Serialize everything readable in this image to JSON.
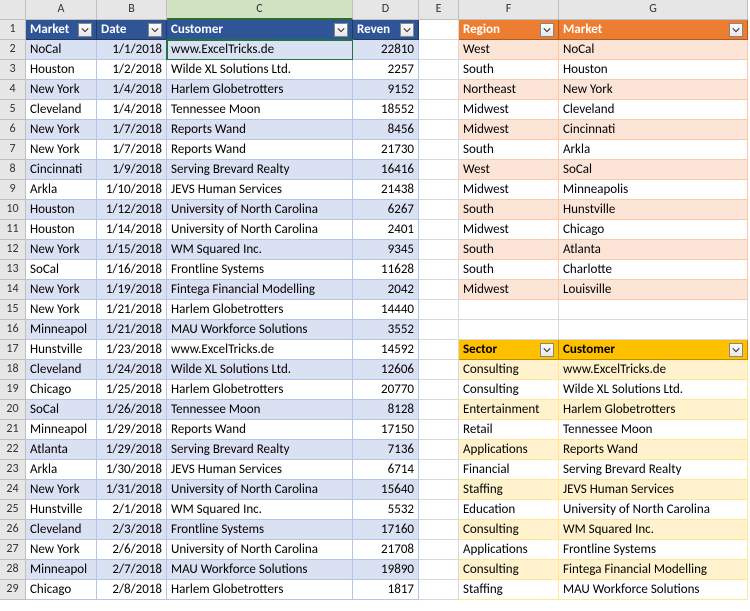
{
  "columns": [
    "A",
    "B",
    "C",
    "D",
    "E",
    "F",
    "G"
  ],
  "table1": {
    "headers": {
      "market": "Market",
      "date": "Date",
      "customer": "Customer",
      "reven": "Reven"
    },
    "rows": [
      {
        "market": "NoCal",
        "date": "1/1/2018",
        "customer": "www.ExcelTricks.de",
        "reven": 22810
      },
      {
        "market": "Houston",
        "date": "1/2/2018",
        "customer": "Wilde XL Solutions Ltd.",
        "reven": 2257
      },
      {
        "market": "New York",
        "date": "1/4/2018",
        "customer": "Harlem Globetrotters",
        "reven": 9152
      },
      {
        "market": "Cleveland",
        "date": "1/4/2018",
        "customer": "Tennessee Moon",
        "reven": 18552
      },
      {
        "market": "New York",
        "date": "1/7/2018",
        "customer": "Reports Wand",
        "reven": 8456
      },
      {
        "market": "New York",
        "date": "1/7/2018",
        "customer": "Reports Wand",
        "reven": 21730
      },
      {
        "market": "Cincinnati",
        "date": "1/9/2018",
        "customer": "Serving Brevard Realty",
        "reven": 16416
      },
      {
        "market": "Arkla",
        "date": "1/10/2018",
        "customer": "JEVS Human Services",
        "reven": 21438
      },
      {
        "market": "Houston",
        "date": "1/12/2018",
        "customer": "University of North Carolina",
        "reven": 6267
      },
      {
        "market": "Houston",
        "date": "1/14/2018",
        "customer": "University of North Carolina",
        "reven": 2401
      },
      {
        "market": "New York",
        "date": "1/15/2018",
        "customer": "WM Squared Inc.",
        "reven": 9345
      },
      {
        "market": "SoCal",
        "date": "1/16/2018",
        "customer": "Frontline Systems",
        "reven": 11628
      },
      {
        "market": "New York",
        "date": "1/19/2018",
        "customer": "Fintega Financial Modelling",
        "reven": 2042
      },
      {
        "market": "New York",
        "date": "1/21/2018",
        "customer": "Harlem Globetrotters",
        "reven": 14440
      },
      {
        "market": "Minneapol",
        "date": "1/21/2018",
        "customer": "MAU Workforce Solutions",
        "reven": 3552
      },
      {
        "market": "Hunstville",
        "date": "1/23/2018",
        "customer": "www.ExcelTricks.de",
        "reven": 14592
      },
      {
        "market": "Cleveland",
        "date": "1/24/2018",
        "customer": "Wilde XL Solutions Ltd.",
        "reven": 12606
      },
      {
        "market": "Chicago",
        "date": "1/25/2018",
        "customer": "Harlem Globetrotters",
        "reven": 20770
      },
      {
        "market": "SoCal",
        "date": "1/26/2018",
        "customer": "Tennessee Moon",
        "reven": 8128
      },
      {
        "market": "Minneapol",
        "date": "1/29/2018",
        "customer": "Reports Wand",
        "reven": 17150
      },
      {
        "market": "Atlanta",
        "date": "1/29/2018",
        "customer": "Serving Brevard Realty",
        "reven": 7136
      },
      {
        "market": "Arkla",
        "date": "1/30/2018",
        "customer": "JEVS Human Services",
        "reven": 6714
      },
      {
        "market": "New York",
        "date": "1/31/2018",
        "customer": "University of North Carolina",
        "reven": 15640
      },
      {
        "market": "Hunstville",
        "date": "2/1/2018",
        "customer": "WM Squared Inc.",
        "reven": 5532
      },
      {
        "market": "Cleveland",
        "date": "2/3/2018",
        "customer": "Frontline Systems",
        "reven": 17160
      },
      {
        "market": "New York",
        "date": "2/6/2018",
        "customer": "University of North Carolina",
        "reven": 21708
      },
      {
        "market": "Minneapol",
        "date": "2/7/2018",
        "customer": "MAU Workforce Solutions",
        "reven": 19890
      },
      {
        "market": "Chicago",
        "date": "2/8/2018",
        "customer": "Harlem Globetrotters",
        "reven": 1817
      }
    ]
  },
  "table2": {
    "headers": {
      "region": "Region",
      "market": "Market"
    },
    "rows": [
      {
        "region": "West",
        "market": "NoCal"
      },
      {
        "region": "South",
        "market": "Houston"
      },
      {
        "region": "Northeast",
        "market": "New York"
      },
      {
        "region": "Midwest",
        "market": "Cleveland"
      },
      {
        "region": "Midwest",
        "market": "Cincinnati"
      },
      {
        "region": "South",
        "market": "Arkla"
      },
      {
        "region": "West",
        "market": "SoCal"
      },
      {
        "region": "Midwest",
        "market": "Minneapolis"
      },
      {
        "region": "South",
        "market": "Hunstville"
      },
      {
        "region": "Midwest",
        "market": "Chicago"
      },
      {
        "region": "South",
        "market": "Atlanta"
      },
      {
        "region": "South",
        "market": "Charlotte"
      },
      {
        "region": "Midwest",
        "market": "Louisville"
      }
    ]
  },
  "table3": {
    "headers": {
      "sector": "Sector",
      "customer": "Customer"
    },
    "rows": [
      {
        "sector": "Consulting",
        "customer": "www.ExcelTricks.de"
      },
      {
        "sector": "Consulting",
        "customer": "Wilde XL Solutions Ltd."
      },
      {
        "sector": "Entertainment",
        "customer": "Harlem Globetrotters"
      },
      {
        "sector": "Retail",
        "customer": "Tennessee Moon"
      },
      {
        "sector": "Applications",
        "customer": "Reports Wand"
      },
      {
        "sector": "Financial",
        "customer": "Serving Brevard Realty"
      },
      {
        "sector": "Staffing",
        "customer": "JEVS Human Services"
      },
      {
        "sector": "Education",
        "customer": "University of North Carolina"
      },
      {
        "sector": "Consulting",
        "customer": "WM Squared Inc."
      },
      {
        "sector": "Applications",
        "customer": "Frontline Systems"
      },
      {
        "sector": "Consulting",
        "customer": "Fintega Financial Modelling"
      },
      {
        "sector": "Staffing",
        "customer": "MAU Workforce Solutions"
      }
    ]
  },
  "active_cell": "C2"
}
